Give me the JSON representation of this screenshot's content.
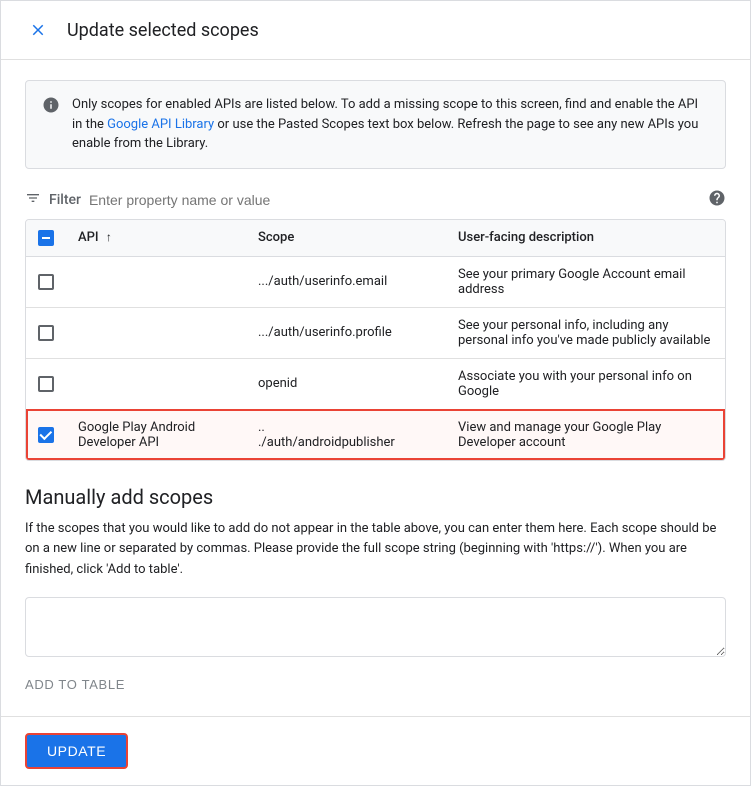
{
  "dialog": {
    "title": "Update selected scopes",
    "close_label": "×"
  },
  "info_box": {
    "text_before_link": "Only scopes for enabled APIs are listed below. To add a missing scope to this screen, find and enable the API in the ",
    "link_text": "Google API Library",
    "text_after_link": " or use the Pasted Scopes text box below. Refresh the page to see any new APIs you enable from the Library."
  },
  "filter": {
    "label": "Filter",
    "placeholder": "Enter property name or value"
  },
  "table": {
    "columns": [
      "",
      "API",
      "Scope",
      "User-facing description"
    ],
    "rows": [
      {
        "checked": false,
        "api": "",
        "scope": ".../auth/userinfo.email",
        "description": "See your primary Google Account email address"
      },
      {
        "checked": false,
        "api": "",
        "scope": ".../auth/userinfo.profile",
        "description": "See your personal info, including any personal info you've made publicly available"
      },
      {
        "checked": false,
        "api": "",
        "scope": "openid",
        "description": "Associate you with your personal info on Google"
      },
      {
        "checked": true,
        "api": "Google Play Android Developer API",
        "scope": "..\n./auth/androidpublisher",
        "description": "View and manage your Google Play Developer account",
        "highlighted": true
      }
    ]
  },
  "manual_add": {
    "title": "Manually add scopes",
    "description": "If the scopes that you would like to add do not appear in the table above, you can enter them here. Each scope should be on a new line or separated by commas. Please provide the full scope string (beginning with 'https://'). When you are finished, click 'Add to table'.",
    "textarea_placeholder": "",
    "add_button_label": "ADD TO TABLE"
  },
  "footer": {
    "update_button_label": "UPDATE"
  }
}
